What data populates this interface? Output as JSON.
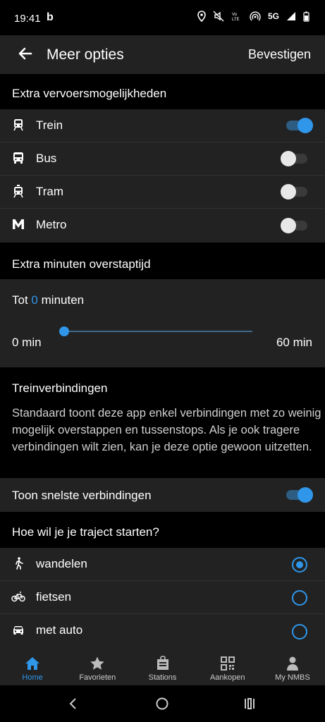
{
  "status": {
    "time": "19:41",
    "b": "b",
    "net": "5G"
  },
  "header": {
    "title": "Meer opties",
    "confirm": "Bevestigen"
  },
  "transport": {
    "heading": "Extra vervoersmogelijkheden",
    "items": [
      {
        "label": "Trein",
        "icon": "train-icon",
        "on": true
      },
      {
        "label": "Bus",
        "icon": "bus-icon",
        "on": false
      },
      {
        "label": "Tram",
        "icon": "tram-icon",
        "on": false
      },
      {
        "label": "Metro",
        "icon": "metro-icon",
        "on": false
      }
    ]
  },
  "transfer": {
    "heading": "Extra minuten overstaptijd",
    "prefix": "Tot",
    "value": "0",
    "suffix": "minuten",
    "min_label": "0 min",
    "max_label": "60 min",
    "slider_fraction": 0
  },
  "connections": {
    "heading": "Treinverbindingen",
    "description": "Standaard toont deze app enkel verbindingen met zo weinig mogelijk overstappen en tussenstops. Als je ook tragere verbindingen wilt zien, kan je deze optie gewoon uitzetten.",
    "fastest_label": "Toon snelste verbindingen",
    "fastest_on": true
  },
  "start": {
    "heading": "Hoe wil je je traject starten?",
    "options": [
      {
        "label": "wandelen",
        "icon": "walk-icon",
        "selected": true
      },
      {
        "label": "fietsen",
        "icon": "bike-icon",
        "selected": false
      },
      {
        "label": "met auto",
        "icon": "car-icon",
        "selected": false
      }
    ]
  },
  "nav": [
    {
      "label": "Home",
      "icon": "home-icon",
      "active": true
    },
    {
      "label": "Favorieten",
      "icon": "star-icon",
      "active": false
    },
    {
      "label": "Stations",
      "icon": "station-icon",
      "active": false
    },
    {
      "label": "Aankopen",
      "icon": "qr-icon",
      "active": false
    },
    {
      "label": "My NMBS",
      "icon": "person-icon",
      "active": false
    }
  ],
  "colors": {
    "accent": "#2f96ea",
    "surface": "#222222",
    "background": "#000000"
  }
}
